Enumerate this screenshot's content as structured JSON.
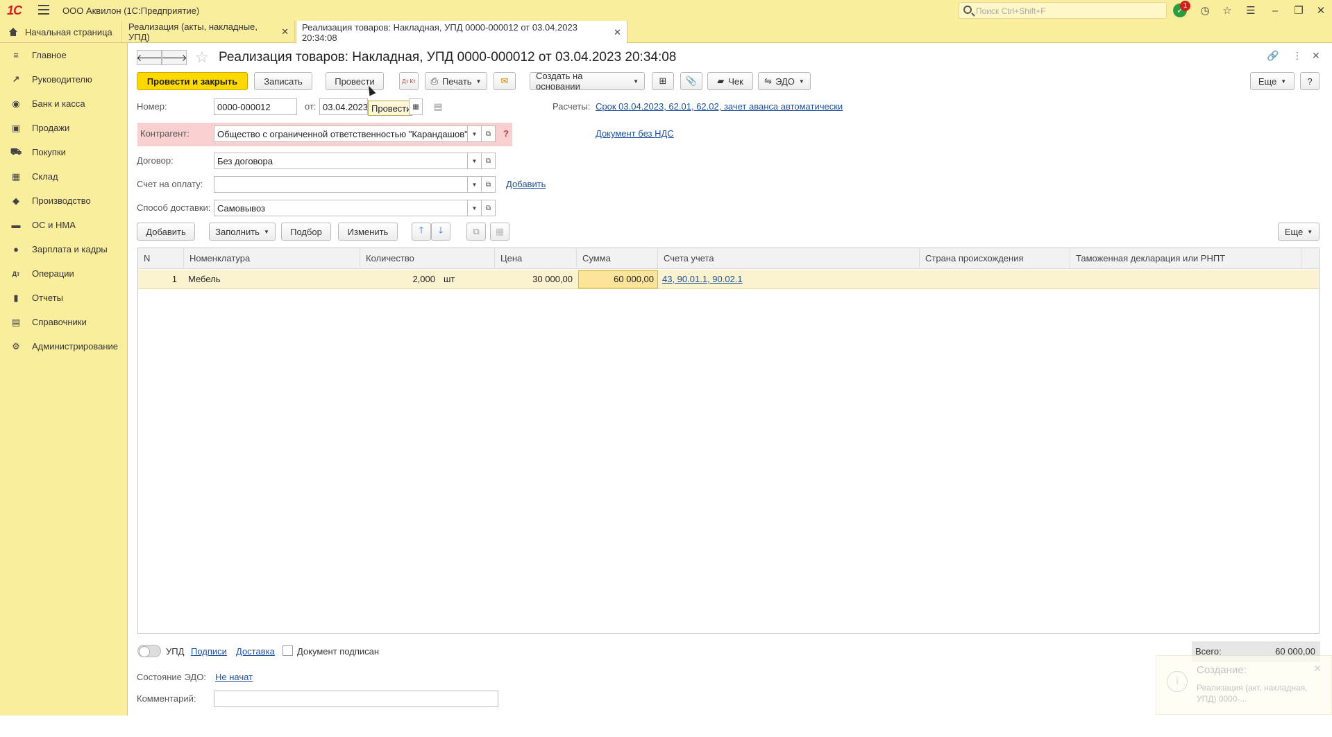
{
  "titlebar": {
    "logo": "1С",
    "title": "ООО Аквилон  (1С:Предприятие)",
    "search_placeholder": "Поиск Ctrl+Shift+F",
    "notification_count": "1"
  },
  "tabs": [
    {
      "label": "Начальная страница"
    },
    {
      "label": "Реализация (акты, накладные, УПД)"
    },
    {
      "label": "Реализация товаров: Накладная, УПД 0000-000012 от 03.04.2023 20:34:08"
    }
  ],
  "sidebar": {
    "items": [
      {
        "label": "Главное",
        "icon": "≡"
      },
      {
        "label": "Руководителю",
        "icon": "↗"
      },
      {
        "label": "Банк и касса",
        "icon": "◉"
      },
      {
        "label": "Продажи",
        "icon": "▣"
      },
      {
        "label": "Покупки",
        "icon": "⛟"
      },
      {
        "label": "Склад",
        "icon": "▦"
      },
      {
        "label": "Производство",
        "icon": "◆"
      },
      {
        "label": "ОС и НМА",
        "icon": "▬"
      },
      {
        "label": "Зарплата и кадры",
        "icon": "●"
      },
      {
        "label": "Операции",
        "icon": "Дт"
      },
      {
        "label": "Отчеты",
        "icon": "▮"
      },
      {
        "label": "Справочники",
        "icon": "▤"
      },
      {
        "label": "Администрирование",
        "icon": "⚙"
      }
    ]
  },
  "document": {
    "title": "Реализация товаров: Накладная, УПД 0000-000012 от 03.04.2023 20:34:08"
  },
  "toolbar": {
    "post_close": "Провести и закрыть",
    "save": "Записать",
    "post": "Провести",
    "dtkt": "Дт Кт",
    "print": "Печать",
    "create_based": "Создать на основании",
    "check": "Чек",
    "edo": "ЭДО",
    "more": "Еще",
    "help": "?",
    "tooltip": "Провести"
  },
  "form": {
    "number_label": "Номер:",
    "number_value": "0000-000012",
    "from_label": "от:",
    "date_value": "03.04.2023",
    "settlements_label": "Расчеты:",
    "settlements_link": "Срок 03.04.2023, 62.01, 62.02, зачет аванса автоматически",
    "vat_link": "Документ без НДС",
    "contractor_label": "Контрагент:",
    "contractor_value": "Общество с ограниченной ответственностью \"Карандашов\"",
    "contract_label": "Договор:",
    "contract_value": "Без договора",
    "invoice_label": "Счет на оплату:",
    "invoice_value": "",
    "add_link": "Добавить",
    "delivery_label": "Способ доставки:",
    "delivery_value": "Самовывоз"
  },
  "table_toolbar": {
    "add": "Добавить",
    "fill": "Заполнить",
    "select": "Подбор",
    "change": "Изменить",
    "more": "Еще"
  },
  "table": {
    "headers": [
      "N",
      "Номенклатура",
      "Количество",
      "Цена",
      "Сумма",
      "Счета учета",
      "Страна происхождения",
      "Таможенная декларация или РНПТ"
    ],
    "rows": [
      {
        "n": "1",
        "item": "Мебель",
        "qty": "2,000",
        "unit": "шт",
        "price": "30 000,00",
        "sum": "60 000,00",
        "accounts": "43, 90.01.1, 90.02.1",
        "country": "",
        "declaration": ""
      }
    ]
  },
  "footer": {
    "upd_label": "УПД",
    "signatures_link": "Подписи",
    "delivery_link": "Доставка",
    "signed_label": "Документ подписан",
    "total_label": "Всего:",
    "total_value": "60 000,00",
    "edo_state_label": "Состояние ЭДО:",
    "edo_state_link": "Не начат",
    "comment_label": "Комментарий:",
    "comment_value": ""
  },
  "notification": {
    "title": "Создание:",
    "text": "Реализация (акт, накладная, УПД) 0000-..."
  }
}
